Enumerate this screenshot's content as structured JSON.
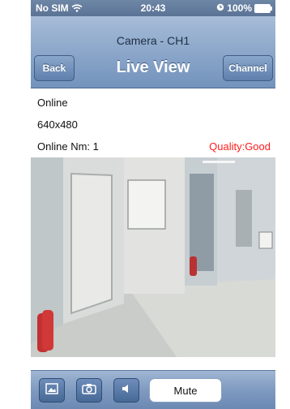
{
  "status": {
    "carrier": "No SIM",
    "time": "20:43",
    "battery": "100%"
  },
  "nav": {
    "subtitle": "Camera - CH1",
    "title": "Live View",
    "back_label": "Back",
    "channel_label": "Channel"
  },
  "info": {
    "status": "Online",
    "resolution": "640x480",
    "online_count": "Online Nm: 1",
    "quality": "Quality:Good"
  },
  "toolbar": {
    "mute_label": "Mute",
    "icons": [
      "picture-icon",
      "camera-icon",
      "speaker-icon"
    ]
  },
  "colors": {
    "nav_top": "#a7bdd8",
    "nav_bottom": "#7393bc",
    "quality_text": "#ff1b1b"
  }
}
